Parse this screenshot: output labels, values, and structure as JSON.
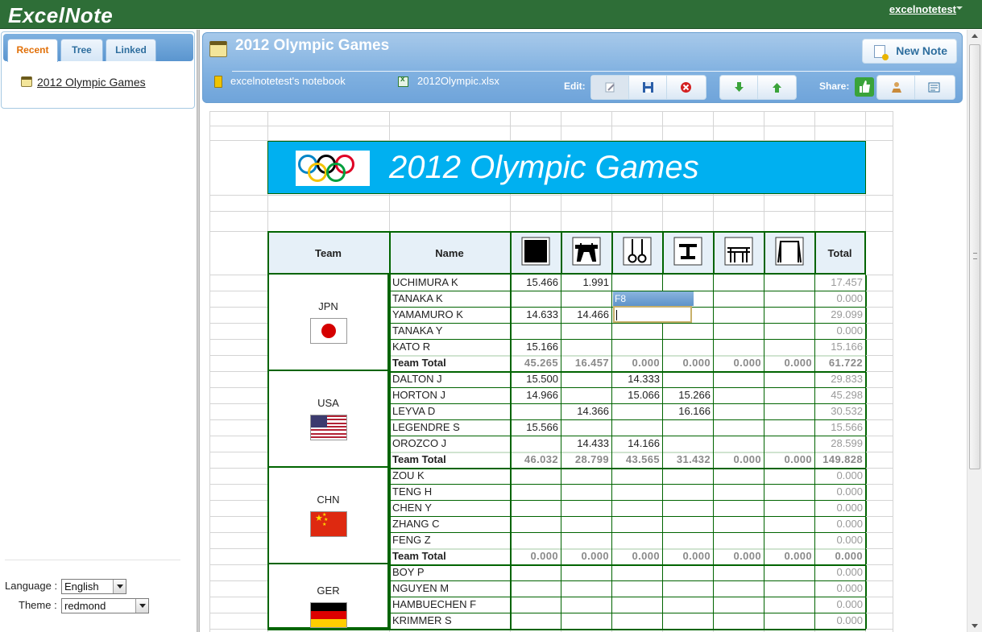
{
  "app": {
    "title": "ExcelNote",
    "user": "excelnotetest"
  },
  "sidebar": {
    "tabs": [
      {
        "label": "Recent"
      },
      {
        "label": "Tree"
      },
      {
        "label": "Linked"
      }
    ],
    "recent_item": "2012 Olympic Games",
    "language_label": "Language :",
    "language_value": "English",
    "theme_label": "Theme :",
    "theme_value": "redmond"
  },
  "note": {
    "title": "2012 Olympic Games",
    "notebook": "excelnotetest's notebook",
    "file": "2012Olympic.xlsx",
    "new_note_label": "New Note",
    "edit_label": "Edit:",
    "share_label": "Share:"
  },
  "sheet": {
    "banner_title": "2012 Olympic Games",
    "header": {
      "team": "Team",
      "name": "Name",
      "total": "Total"
    },
    "apparatus_icons": [
      "floor-icon",
      "pommel-horse-icon",
      "rings-icon",
      "vault-icon",
      "parallel-bars-icon",
      "high-bar-icon"
    ],
    "active_cell": "F8",
    "teams": [
      {
        "code": "JPN",
        "flag": "japan-flag",
        "rows": [
          {
            "name": "UCHIMURA K",
            "scores": [
              "15.466",
              "1.991",
              "",
              "",
              "",
              ""
            ],
            "total": "17.457"
          },
          {
            "name": "TANAKA K",
            "scores": [
              "",
              "",
              "",
              "",
              "",
              ""
            ],
            "total": "0.000"
          },
          {
            "name": "YAMAMURO K",
            "scores": [
              "14.633",
              "14.466",
              "",
              "",
              "",
              ""
            ],
            "total": "29.099"
          },
          {
            "name": "TANAKA Y",
            "scores": [
              "",
              "",
              "",
              "",
              "",
              ""
            ],
            "total": "0.000"
          },
          {
            "name": "KATO R",
            "scores": [
              "15.166",
              "",
              "",
              "",
              "",
              ""
            ],
            "total": "15.166"
          }
        ],
        "team_total": {
          "label": "Team Total",
          "values": [
            "45.265",
            "16.457",
            "0.000",
            "0.000",
            "0.000",
            "0.000"
          ],
          "total": "61.722"
        }
      },
      {
        "code": "USA",
        "flag": "usa-flag",
        "rows": [
          {
            "name": "DALTON J",
            "scores": [
              "15.500",
              "",
              "14.333",
              "",
              "",
              ""
            ],
            "total": "29.833"
          },
          {
            "name": "HORTON J",
            "scores": [
              "14.966",
              "",
              "15.066",
              "15.266",
              "",
              ""
            ],
            "total": "45.298"
          },
          {
            "name": "LEYVA D",
            "scores": [
              "",
              "14.366",
              "",
              "16.166",
              "",
              ""
            ],
            "total": "30.532"
          },
          {
            "name": "LEGENDRE S",
            "scores": [
              "15.566",
              "",
              "",
              "",
              "",
              ""
            ],
            "total": "15.566"
          },
          {
            "name": "OROZCO J",
            "scores": [
              "",
              "14.433",
              "14.166",
              "",
              "",
              ""
            ],
            "total": "28.599"
          }
        ],
        "team_total": {
          "label": "Team Total",
          "values": [
            "46.032",
            "28.799",
            "43.565",
            "31.432",
            "0.000",
            "0.000"
          ],
          "total": "149.828"
        }
      },
      {
        "code": "CHN",
        "flag": "china-flag",
        "rows": [
          {
            "name": "ZOU K",
            "scores": [
              "",
              "",
              "",
              "",
              "",
              ""
            ],
            "total": "0.000"
          },
          {
            "name": "TENG H",
            "scores": [
              "",
              "",
              "",
              "",
              "",
              ""
            ],
            "total": "0.000"
          },
          {
            "name": "CHEN Y",
            "scores": [
              "",
              "",
              "",
              "",
              "",
              ""
            ],
            "total": "0.000"
          },
          {
            "name": "ZHANG C",
            "scores": [
              "",
              "",
              "",
              "",
              "",
              ""
            ],
            "total": "0.000"
          },
          {
            "name": "FENG Z",
            "scores": [
              "",
              "",
              "",
              "",
              "",
              ""
            ],
            "total": "0.000"
          }
        ],
        "team_total": {
          "label": "Team Total",
          "values": [
            "0.000",
            "0.000",
            "0.000",
            "0.000",
            "0.000",
            "0.000"
          ],
          "total": "0.000"
        }
      },
      {
        "code": "GER",
        "flag": "germany-flag",
        "rows": [
          {
            "name": "BOY P",
            "scores": [
              "",
              "",
              "",
              "",
              "",
              ""
            ],
            "total": "0.000"
          },
          {
            "name": "NGUYEN M",
            "scores": [
              "",
              "",
              "",
              "",
              "",
              ""
            ],
            "total": "0.000"
          },
          {
            "name": "HAMBUECHEN F",
            "scores": [
              "",
              "",
              "",
              "",
              "",
              ""
            ],
            "total": "0.000"
          },
          {
            "name": "KRIMMER S",
            "scores": [
              "",
              "",
              "",
              "",
              "",
              ""
            ],
            "total": "0.000"
          }
        ]
      }
    ]
  },
  "colors": {
    "topbar": "#2e6e37",
    "banner": "#00b0f0",
    "grid_border": "#006400",
    "header_panel": "#7fb0e0",
    "active_tab_text": "#e17009"
  }
}
